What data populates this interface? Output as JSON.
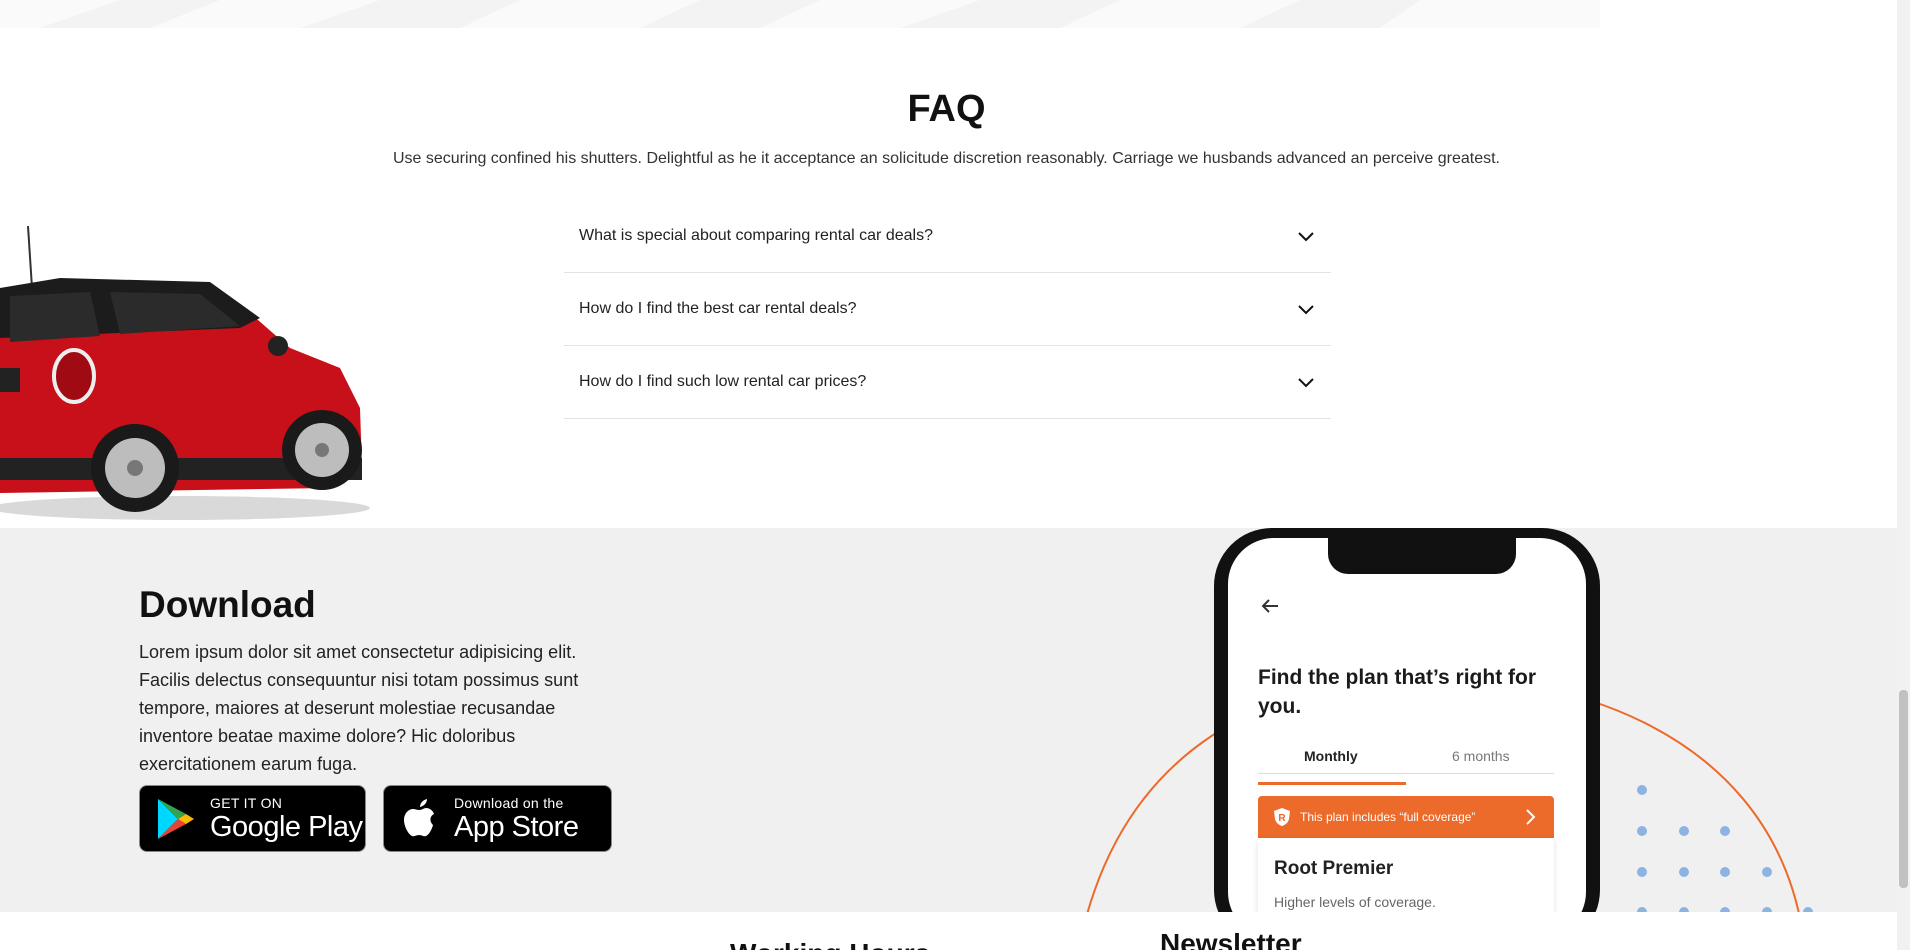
{
  "faq": {
    "title": "FAQ",
    "subtitle": "Use securing confined his shutters. Delightful as he it acceptance an solicitude discretion reasonably. Carriage we husbands advanced an perceive greatest.",
    "items": [
      {
        "question": "What is special about comparing rental car deals?",
        "icon": "chevron-down-icon"
      },
      {
        "question": "How do I find the best car rental deals?",
        "icon": "chevron-down-icon"
      },
      {
        "question": "How do I find such low rental car prices?",
        "icon": "chevron-down-icon"
      }
    ]
  },
  "download": {
    "title": "Download",
    "text": "Lorem ipsum dolor sit amet consectetur adipisicing elit. Facilis delectus consequuntur nisi totam possimus sunt tempore, maiores at deserunt molestiae recusandae inventore beatae maxime dolore? Hic doloribus exercitationem earum fuga.",
    "google_play": {
      "small": "GET IT ON",
      "big": "Google Play"
    },
    "app_store": {
      "small": "Download on the",
      "big": "App Store"
    }
  },
  "phone": {
    "title": "Find the plan that’s right for you.",
    "tabs": [
      "Monthly",
      "6 months"
    ],
    "banner": "This plan includes “full coverage”",
    "card_title": "Root Premier",
    "card_sub": "Higher levels of coverage."
  },
  "footer": {
    "heading_left": "Working Hours",
    "heading_right": "Newsletter"
  },
  "colors": {
    "accent": "#ec6a2a",
    "section_bg": "#f0f0f0",
    "car_red": "#c8101a"
  }
}
